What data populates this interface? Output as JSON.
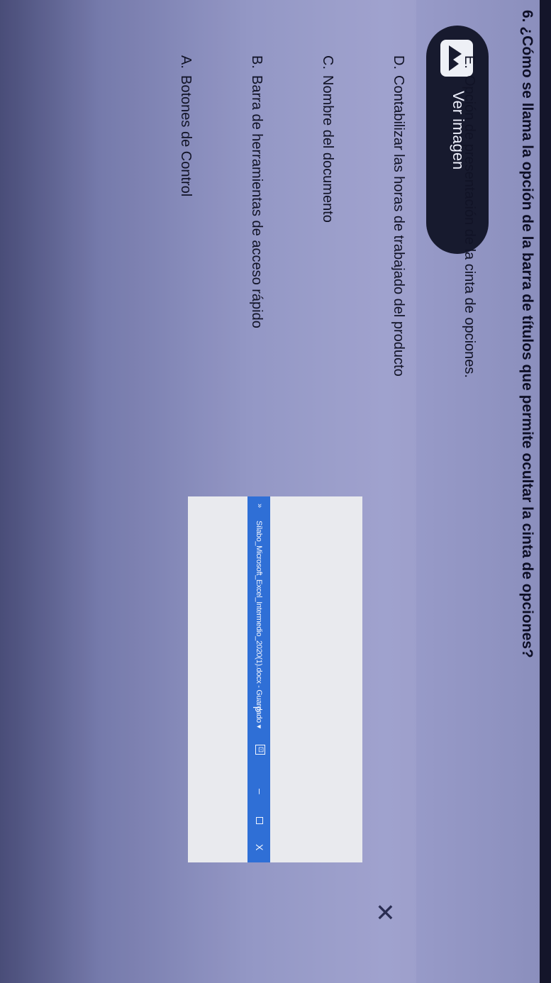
{
  "question": "6. ¿Cómo se llama la opción de la barra de títulos que permite ocultar la cinta de opciones?",
  "view_button": {
    "label": "Ver imagen",
    "icon": "image-icon"
  },
  "options": [
    {
      "letter": "A.",
      "text": "Botones de Control"
    },
    {
      "letter": "B.",
      "text": "Barra de herramientas de acceso rápido"
    },
    {
      "letter": "C.",
      "text": "Nombre del documento"
    },
    {
      "letter": "D.",
      "text": "Contabilizar las horas de trabajado del producto"
    },
    {
      "letter": "E.",
      "text": "Opción de presentación de la cinta de opciones."
    }
  ],
  "close_glyph": "✕",
  "image_panel": {
    "quick_access": "»",
    "document_title": "Sílabo_Microsoft_Excel_Intermedio_2020(1).docx - Guardado ▾",
    "search_glyph": "ρ",
    "ribbon_glyph": "⊡",
    "minimize_glyph": "–",
    "close_glyph": "X",
    "titlebar_color": "#2f6fd6"
  }
}
